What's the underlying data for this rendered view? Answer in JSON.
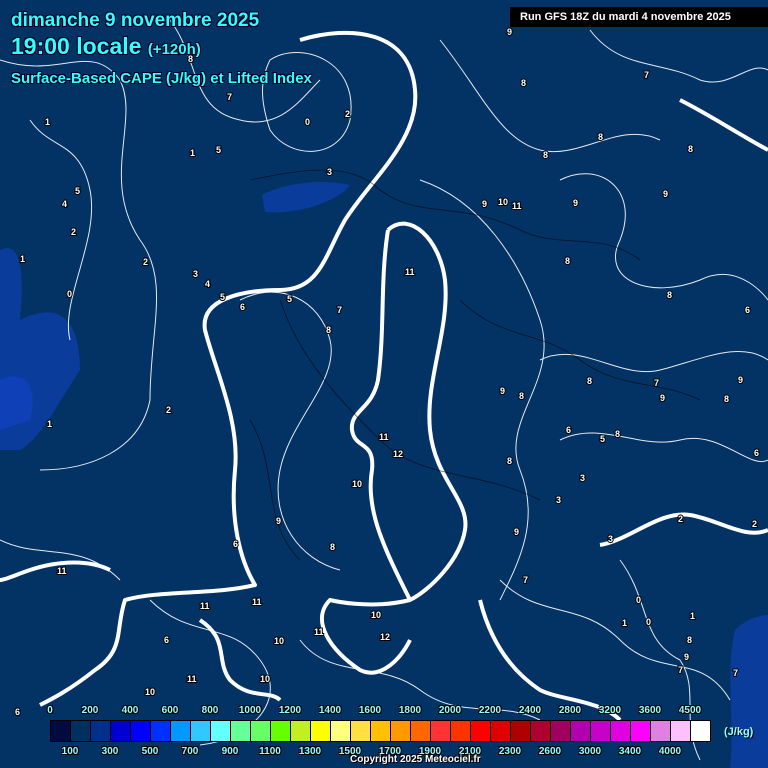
{
  "header": {
    "date": "dimanche 9 novembre 2025",
    "time": "19:00 locale",
    "lead": "(+120h)",
    "title": "Surface-Based CAPE (J/kg) et Lifted Index",
    "run": "Run GFS 18Z du mardi 4 novembre 2025"
  },
  "legend": {
    "colors": [
      "#000c40",
      "#003060",
      "#00308c",
      "#0000d0",
      "#0000ff",
      "#0030ff",
      "#0099ff",
      "#30c8ff",
      "#66ffff",
      "#66ff99",
      "#66ff66",
      "#66ff00",
      "#c0f020",
      "#ffff00",
      "#ffff80",
      "#ffe040",
      "#ffc000",
      "#ff9900",
      "#ff6600",
      "#ff3333",
      "#ff3300",
      "#ff0000",
      "#e00000",
      "#b00000",
      "#b00030",
      "#a00060",
      "#b000b0",
      "#c800c8",
      "#e000e0",
      "#ff00ff",
      "#e080e0",
      "#ffc0ff",
      "#ffffff"
    ],
    "top_labels": [
      "0",
      "200",
      "400",
      "600",
      "800",
      "1000",
      "1200",
      "1400",
      "1600",
      "1800",
      "2000",
      "2200",
      "2400",
      "2800",
      "3200",
      "3600",
      "4500"
    ],
    "bottom_labels": [
      "100",
      "300",
      "500",
      "700",
      "900",
      "1100",
      "1300",
      "1500",
      "1700",
      "1900",
      "2100",
      "2300",
      "2600",
      "3000",
      "3400",
      "4000"
    ],
    "unit": "(J/kg)"
  },
  "copyright": "Copyright 2025 Meteociel.fr",
  "map_labels": [
    "1",
    "0",
    "2",
    "3",
    "8",
    "7",
    "5",
    "1",
    "5",
    "4",
    "2",
    "1",
    "2",
    "3",
    "4",
    "5",
    "6",
    "5",
    "7",
    "8",
    "0",
    "2",
    "1",
    "11",
    "12",
    "10",
    "11",
    "9",
    "8",
    "6",
    "11",
    "11",
    "11",
    "10",
    "10",
    "11",
    "12",
    "10",
    "11",
    "10",
    "9",
    "10",
    "11",
    "8",
    "9",
    "8",
    "8",
    "9",
    "7",
    "8",
    "9",
    "8",
    "6",
    "9",
    "8",
    "8",
    "7",
    "9",
    "8",
    "9",
    "6",
    "8",
    "6",
    "5",
    "3",
    "3",
    "2",
    "2",
    "3",
    "0",
    "1",
    "0",
    "8",
    "7",
    "9",
    "7",
    "8",
    "9",
    "7",
    "8",
    "6",
    "6",
    "1"
  ]
}
